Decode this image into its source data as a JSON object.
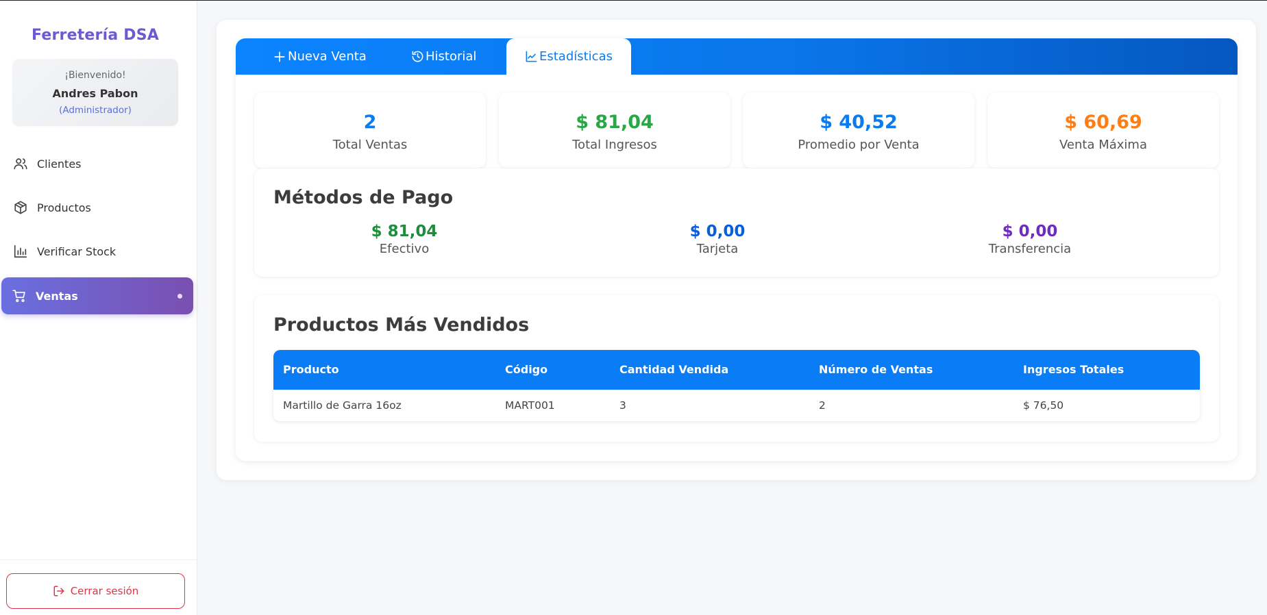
{
  "sidebar": {
    "brand": "Ferretería DSA",
    "welcome": {
      "greeting": "¡Bienvenido!",
      "user": "Andres Pabon",
      "role": "(Administrador)"
    },
    "items": [
      {
        "label": "Clientes",
        "icon": "users-icon"
      },
      {
        "label": "Productos",
        "icon": "box-icon"
      },
      {
        "label": "Verificar Stock",
        "icon": "bar-chart-icon"
      },
      {
        "label": "Ventas",
        "icon": "cart-icon",
        "active": true
      }
    ],
    "logout_label": "Cerrar sesión"
  },
  "tabs": [
    {
      "label": "Nueva Venta",
      "icon": "plus-icon"
    },
    {
      "label": "Historial",
      "icon": "history-icon"
    },
    {
      "label": "Estadísticas",
      "icon": "trend-icon",
      "active": true
    }
  ],
  "stats": [
    {
      "value": "2",
      "label": "Total Ventas",
      "color": "#0b7bf0"
    },
    {
      "value": "$ 81,04",
      "label": "Total Ingresos",
      "color": "#28a745"
    },
    {
      "value": "$ 40,52",
      "label": "Promedio por Venta",
      "color": "#0b7bf0"
    },
    {
      "value": "$ 60,69",
      "label": "Venta Máxima",
      "color": "#fd7e14"
    }
  ],
  "payment_methods": {
    "title": "Métodos de Pago",
    "items": [
      {
        "value": "$ 81,04",
        "label": "Efectivo",
        "color": "#1e8e3e"
      },
      {
        "value": "$ 0,00",
        "label": "Tarjeta",
        "color": "#0b5ed7"
      },
      {
        "value": "$ 0,00",
        "label": "Transferencia",
        "color": "#6f2dbd"
      }
    ]
  },
  "top_products": {
    "title": "Productos Más Vendidos",
    "columns": [
      "Producto",
      "Código",
      "Cantidad Vendida",
      "Número de Ventas",
      "Ingresos Totales"
    ],
    "rows": [
      [
        "Martillo de Garra 16oz",
        "MART001",
        "3",
        "2",
        "$ 76,50"
      ]
    ]
  }
}
